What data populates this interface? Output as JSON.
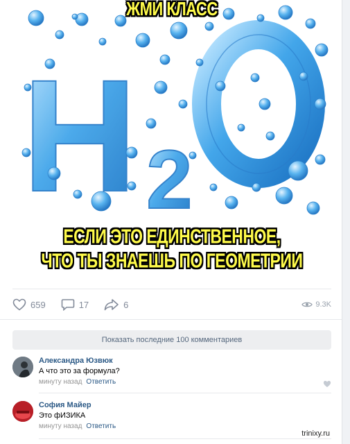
{
  "meme": {
    "caption_top": "ЖМИ КЛАСС",
    "caption_bottom_line1": "ЕСЛИ ЭТО ЕДИНСТВЕННОЕ,",
    "caption_bottom_line2": "ЧТО ТЫ ЗНАЕШЬ ПО ГЕОМЕТРИИ",
    "formula_letter1": "H",
    "formula_subscript": "2",
    "formula_letter2": "O"
  },
  "actions": {
    "likes": "659",
    "comments": "17",
    "shares": "6",
    "views": "9.3K"
  },
  "show_more": "Показать последние 100 комментариев",
  "comments": [
    {
      "author": "Александра Юзвюк",
      "text": "А что это за формула?",
      "time": "минуту назад",
      "reply": "Ответить"
    },
    {
      "author": "София Майер",
      "text": "Это фИЗИКА",
      "time": "минуту назад",
      "reply": "Ответить"
    }
  ],
  "watermark": "trinixy.ru",
  "colors": {
    "accent": "#2a5885",
    "caption": "#fffb4a",
    "water": "#3fa2e8"
  }
}
